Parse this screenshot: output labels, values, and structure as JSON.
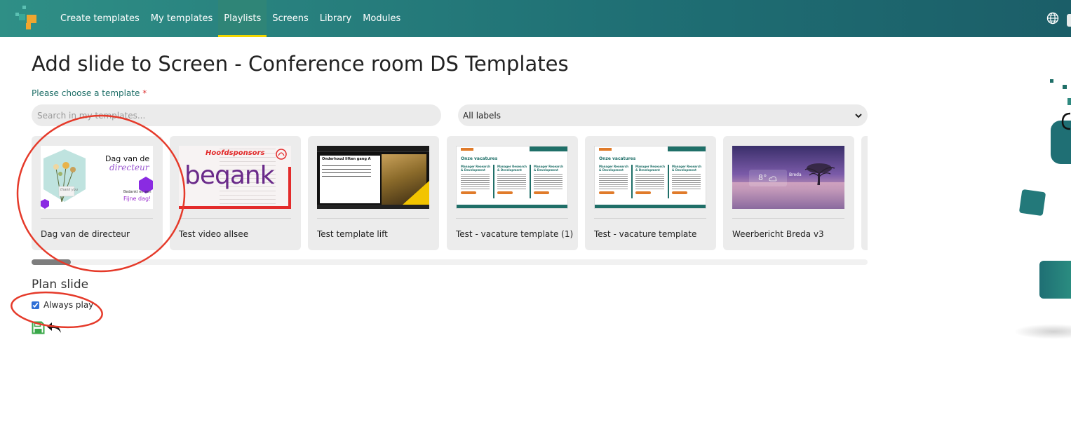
{
  "nav": {
    "items": [
      {
        "label": "Create templates",
        "active": false
      },
      {
        "label": "My templates",
        "active": false
      },
      {
        "label": "Playlists",
        "active": true
      },
      {
        "label": "Screens",
        "active": false
      },
      {
        "label": "Library",
        "active": false
      },
      {
        "label": "Modules",
        "active": false
      }
    ],
    "globe_icon": "globe-icon"
  },
  "page": {
    "title": "Add slide to Screen - Conference room  DS Templates",
    "choose_label": "Please choose a template",
    "required_mark": "*"
  },
  "search": {
    "placeholder": "Search in my templates..."
  },
  "labels_filter": {
    "selected": "All labels"
  },
  "templates": [
    {
      "title": "Dag van de directeur",
      "thumb": {
        "heading": "Dag van de",
        "script": "directeur",
        "note": "Bedankt en een",
        "closing": "Fijne dag!",
        "card_text": "thank you"
      }
    },
    {
      "title": "Test video allsee",
      "thumb": {
        "banner": "Hoofdsponsors",
        "big_text": "beqank"
      }
    },
    {
      "title": "Test template lift",
      "thumb": {
        "heading": "Onderhoud liften gang A"
      }
    },
    {
      "title": "Test - vacature template (1)",
      "thumb": {
        "heading": "Onze vacatures",
        "jobs": [
          "Manager Research & Development",
          "Manager Research & Development",
          "Manager Research & Development"
        ]
      }
    },
    {
      "title": "Test - vacature template",
      "thumb": {
        "heading": "Onze vacatures",
        "jobs": [
          "Manager Research & Development",
          "Manager Research & Development",
          "Manager Research & Development"
        ]
      }
    },
    {
      "title": "Weerbericht  Breda v3",
      "thumb": {
        "temp": "8°",
        "city": "Breda"
      }
    }
  ],
  "plan": {
    "title": "Plan slide",
    "always_play_label": "Always play",
    "always_play_checked": true
  },
  "colors": {
    "header_teal": "#1f6f74",
    "accent_yellow": "#f2d600",
    "annotation_red": "#e53a2a",
    "save_green": "#3aa84a"
  }
}
